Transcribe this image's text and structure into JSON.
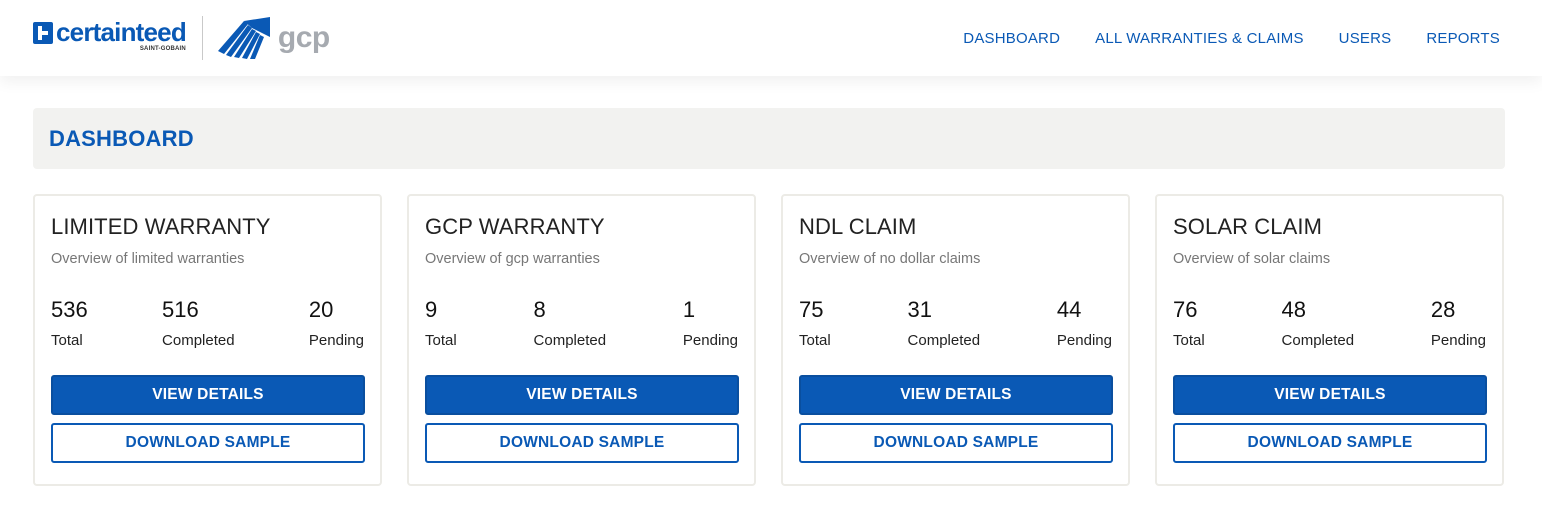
{
  "brand": {
    "primary_logo_text": "certainteed",
    "primary_logo_subtext": "SAINT-GOBAIN",
    "secondary_logo_text": "gcp",
    "accent_color": "#0a59b5"
  },
  "nav": {
    "items": [
      {
        "label": "DASHBOARD"
      },
      {
        "label": "ALL WARRANTIES & CLAIMS"
      },
      {
        "label": "USERS"
      },
      {
        "label": "REPORTS"
      }
    ]
  },
  "page": {
    "title": "DASHBOARD"
  },
  "cards": [
    {
      "title": "LIMITED WARRANTY",
      "subtitle": "Overview of limited warranties",
      "stats": [
        {
          "value": "536",
          "label": "Total"
        },
        {
          "value": "516",
          "label": "Completed"
        },
        {
          "value": "20",
          "label": "Pending"
        }
      ],
      "primary_button": "VIEW DETAILS",
      "secondary_button": "DOWNLOAD SAMPLE"
    },
    {
      "title": "GCP WARRANTY",
      "subtitle": "Overview of gcp warranties",
      "stats": [
        {
          "value": "9",
          "label": "Total"
        },
        {
          "value": "8",
          "label": "Completed"
        },
        {
          "value": "1",
          "label": "Pending"
        }
      ],
      "primary_button": "VIEW DETAILS",
      "secondary_button": "DOWNLOAD SAMPLE"
    },
    {
      "title": "NDL CLAIM",
      "subtitle": "Overview of no dollar claims",
      "stats": [
        {
          "value": "75",
          "label": "Total"
        },
        {
          "value": "31",
          "label": "Completed"
        },
        {
          "value": "44",
          "label": "Pending"
        }
      ],
      "primary_button": "VIEW DETAILS",
      "secondary_button": "DOWNLOAD SAMPLE"
    },
    {
      "title": "SOLAR CLAIM",
      "subtitle": "Overview of solar claims",
      "stats": [
        {
          "value": "76",
          "label": "Total"
        },
        {
          "value": "48",
          "label": "Completed"
        },
        {
          "value": "28",
          "label": "Pending"
        }
      ],
      "primary_button": "VIEW DETAILS",
      "secondary_button": "DOWNLOAD SAMPLE"
    }
  ]
}
